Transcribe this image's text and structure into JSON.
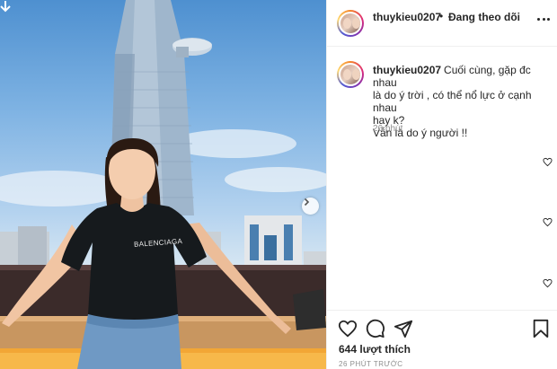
{
  "post": {
    "username": "thuykieu0207",
    "follow_status": "Đang theo dõi",
    "separator": "•",
    "caption_lines": [
      "Cuối cùng, gặp đc nhau",
      "là do ý trời , có thể nổ lực ở cạnh nhau",
      "hay k?",
      "Vẫn là do ý người !!"
    ],
    "caption_time": "26 phút",
    "likes": "644 lượt thích",
    "posted_ago": "26 PHÚT TRƯỚC",
    "photo_shirt_text": "BALENCIAGA"
  },
  "icons": {
    "download": "download-icon",
    "next": "chevron-right-icon",
    "more": "more-options-icon",
    "like": "heart-icon",
    "comment": "comment-icon",
    "share": "share-icon",
    "save": "bookmark-icon"
  },
  "colors": {
    "text": "#262626",
    "muted": "#8e8e8e",
    "divider": "#efefef"
  }
}
